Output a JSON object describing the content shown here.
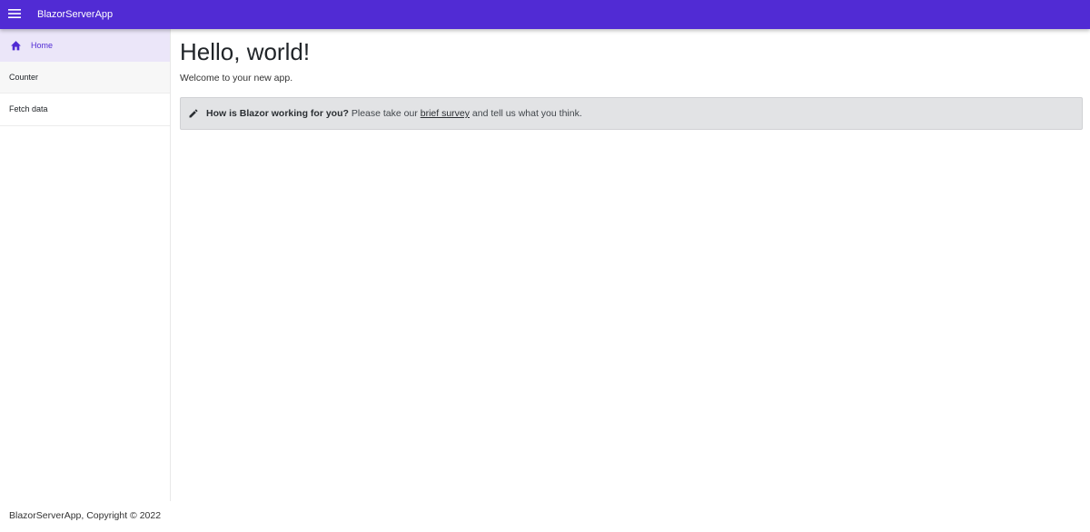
{
  "app": {
    "title": "BlazorServerApp",
    "accent_color": "#512bd4",
    "menu_icon": "hamburger-menu-icon"
  },
  "sidebar": {
    "items": [
      {
        "label": "Home",
        "icon": "home-icon",
        "active": true
      },
      {
        "label": "Counter",
        "icon": "",
        "active": false
      },
      {
        "label": "Fetch data",
        "icon": "",
        "active": false
      }
    ]
  },
  "main": {
    "title": "Hello, world!",
    "welcome": "Welcome to your new app.",
    "survey": {
      "icon": "pencil-icon",
      "question": "How is Blazor working for you?",
      "prefix": " Please take our ",
      "link": "brief survey",
      "suffix": " and tell us what you think."
    }
  },
  "footer": {
    "text": "BlazorServerApp, Copyright © 2022"
  }
}
